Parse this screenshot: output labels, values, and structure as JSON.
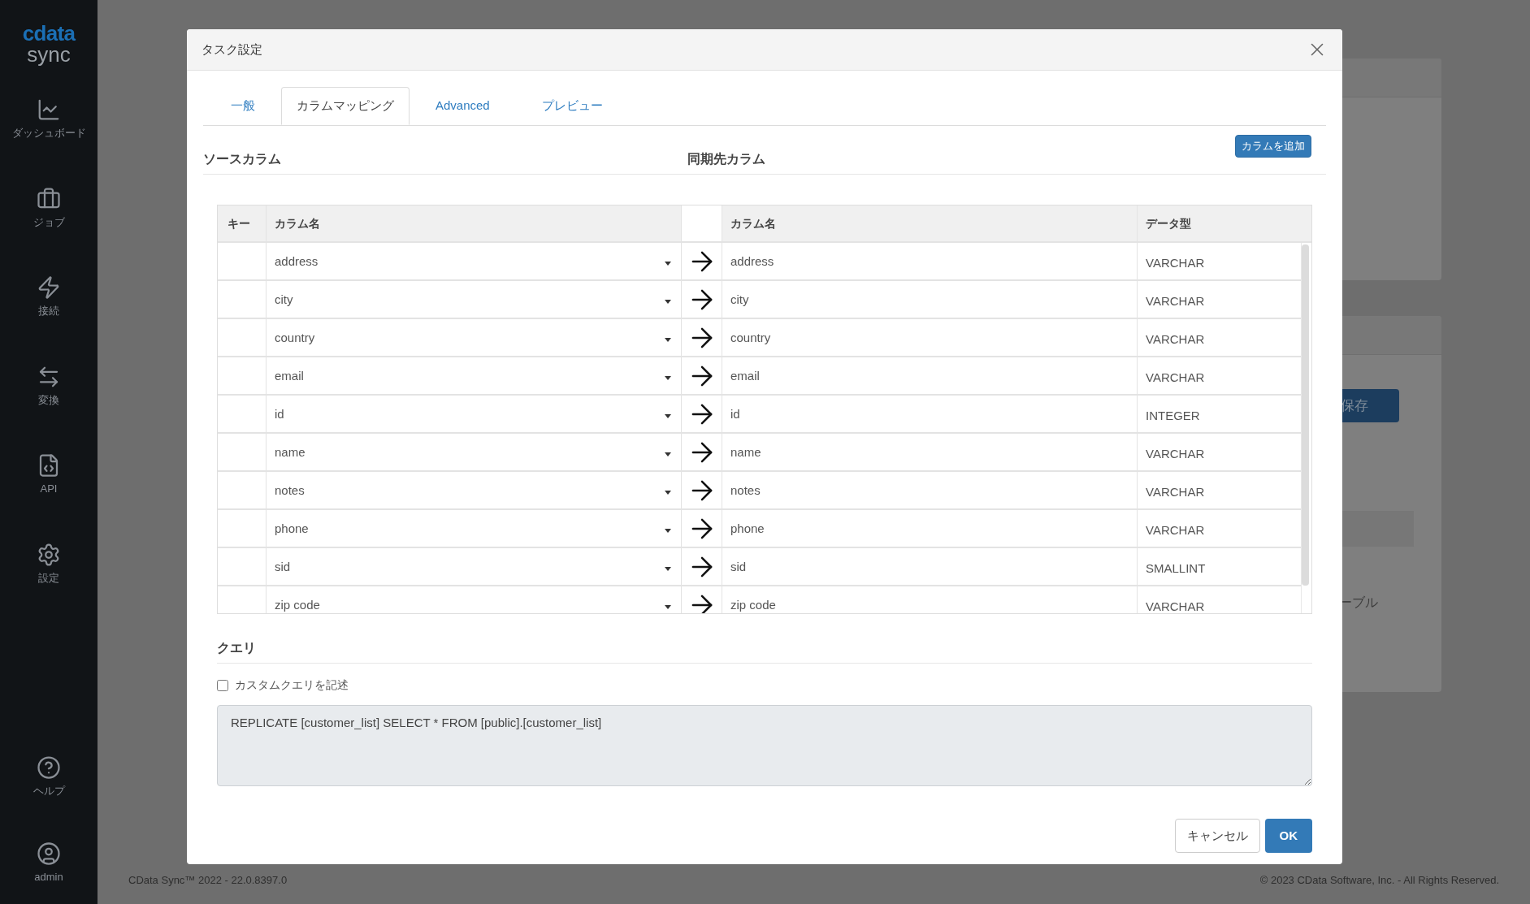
{
  "sidebar": {
    "logo": "cdata",
    "product": "sync",
    "items": [
      {
        "label": "ダッシュボード"
      },
      {
        "label": "ジョブ"
      },
      {
        "label": "接続"
      },
      {
        "label": "変換"
      },
      {
        "label": "API"
      },
      {
        "label": "設定"
      }
    ],
    "bottom_items": [
      {
        "label": "ヘルプ"
      },
      {
        "label": "admin"
      }
    ]
  },
  "background": {
    "save_button": "保存",
    "table_label": "ーブル"
  },
  "footer": {
    "version": "CData Sync™ 2022 - 22.0.8397.0",
    "copyright": "© 2023 CData Software, Inc. - All Rights Reserved."
  },
  "dialog": {
    "title": "タスク設定",
    "tabs": [
      {
        "label": "一般",
        "selected": false
      },
      {
        "label": "カラムマッピング",
        "selected": true
      },
      {
        "label": "Advanced",
        "selected": false
      },
      {
        "label": "プレビュー",
        "selected": false
      }
    ],
    "source_heading": "ソースカラム",
    "target_heading": "同期先カラム",
    "add_column_button": "カラムを追加",
    "table": {
      "columns": [
        "キー",
        "カラム名",
        "カラム名",
        "データ型"
      ],
      "rows": [
        {
          "source": "address",
          "target": "address",
          "type": "VARCHAR"
        },
        {
          "source": "city",
          "target": "city",
          "type": "VARCHAR"
        },
        {
          "source": "country",
          "target": "country",
          "type": "VARCHAR"
        },
        {
          "source": "email",
          "target": "email",
          "type": "VARCHAR"
        },
        {
          "source": "id",
          "target": "id",
          "type": "INTEGER"
        },
        {
          "source": "name",
          "target": "name",
          "type": "VARCHAR"
        },
        {
          "source": "notes",
          "target": "notes",
          "type": "VARCHAR"
        },
        {
          "source": "phone",
          "target": "phone",
          "type": "VARCHAR"
        },
        {
          "source": "sid",
          "target": "sid",
          "type": "SMALLINT"
        },
        {
          "source": "zip code",
          "target": "zip code",
          "type": "VARCHAR"
        }
      ]
    },
    "query_heading": "クエリ",
    "custom_query": {
      "label": "カスタムクエリを記述",
      "checked": false
    },
    "query": "REPLICATE [customer_list] SELECT * FROM [public].[customer_list]",
    "buttons": {
      "cancel": "キャンセル",
      "ok": "OK"
    }
  }
}
